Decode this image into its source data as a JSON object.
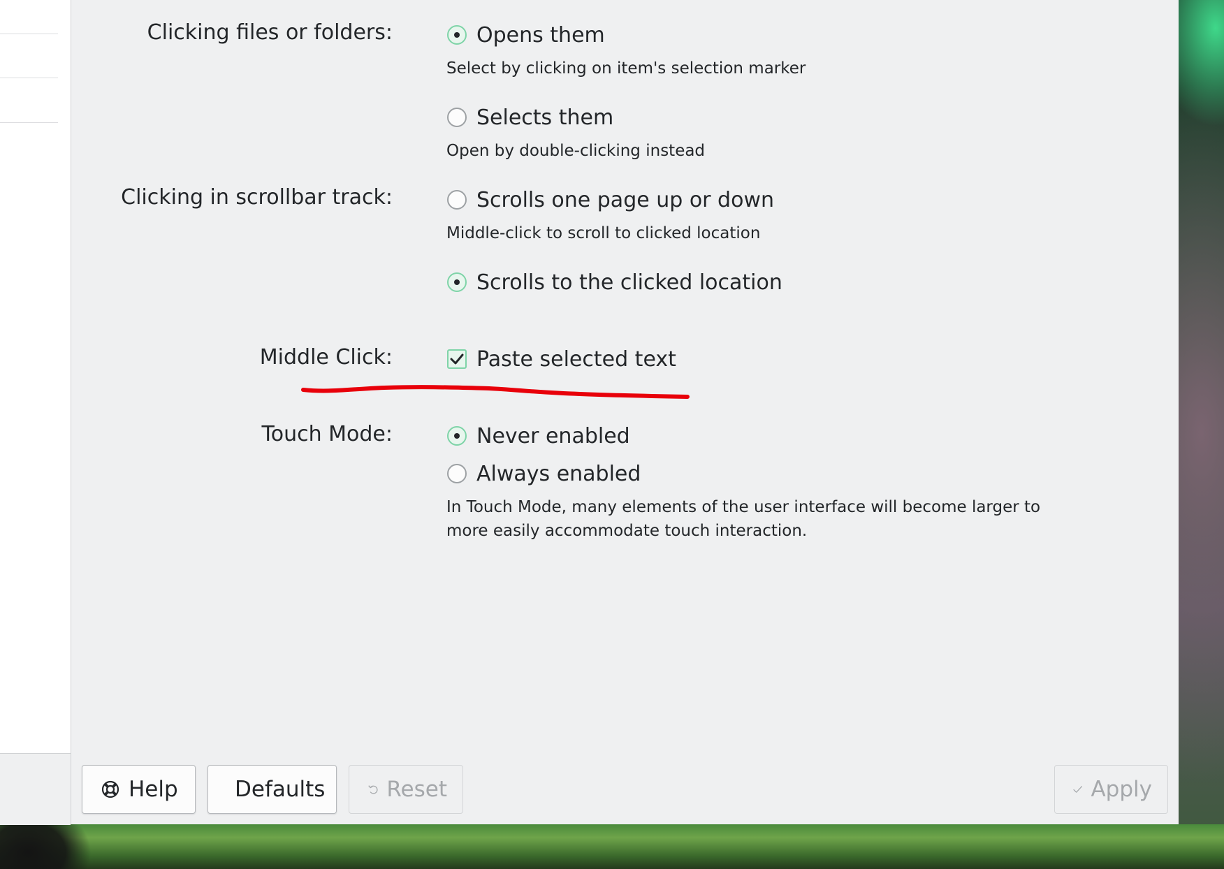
{
  "settings": {
    "clicking_files": {
      "label": "Clicking files or folders:",
      "options": [
        {
          "label": "Opens them",
          "checked": true,
          "hint": "Select by clicking on item's selection marker"
        },
        {
          "label": "Selects them",
          "checked": false,
          "hint": "Open by double-clicking instead"
        }
      ]
    },
    "scrollbar_track": {
      "label": "Clicking in scrollbar track:",
      "options": [
        {
          "label": "Scrolls one page up or down",
          "checked": false,
          "hint": "Middle-click to scroll to clicked location"
        },
        {
          "label": "Scrolls to the clicked location",
          "checked": true
        }
      ]
    },
    "middle_click": {
      "label": "Middle Click:",
      "checkbox_label": "Paste selected text",
      "checked": true
    },
    "touch_mode": {
      "label": "Touch Mode:",
      "options": [
        {
          "label": "Never enabled",
          "checked": true
        },
        {
          "label": "Always enabled",
          "checked": false
        }
      ],
      "hint_line1": "In Touch Mode, many elements of the user interface will become larger to",
      "hint_line2": "more easily accommodate touch interaction."
    }
  },
  "footer": {
    "help": {
      "label": "Help",
      "icon": "help-lifebuoy-icon"
    },
    "defaults": {
      "label": "Defaults",
      "icon": "document-defaults-icon"
    },
    "reset": {
      "label": "Reset",
      "icon": "undo-icon",
      "enabled": false
    },
    "apply": {
      "label": "Apply",
      "icon": "checkmark-icon",
      "enabled": false
    }
  },
  "colors": {
    "accent": "#7fd4a8",
    "annotation": "#e8000a",
    "window_bg": "#eff0f1"
  }
}
